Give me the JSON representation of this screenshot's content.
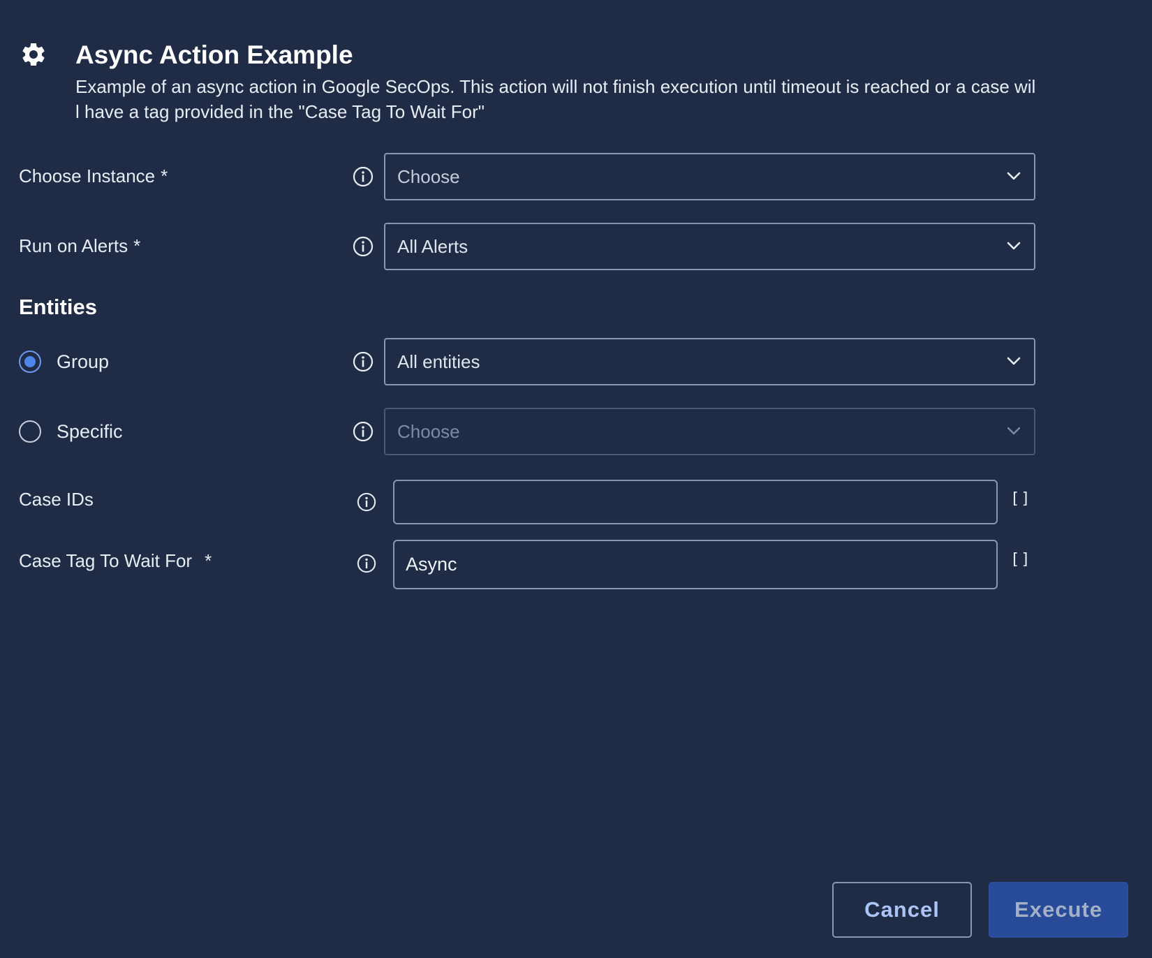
{
  "dialog": {
    "title": "Async Action Example",
    "description": "Example of an async action in Google SecOps. This action will not finish execution until timeout is reached or a case will have a tag provided in the \"Case Tag To Wait For\""
  },
  "fields": {
    "instance": {
      "label": "Choose Instance",
      "required": "*",
      "value": "Choose"
    },
    "alerts": {
      "label": "Run on Alerts",
      "required": "*",
      "value": "All Alerts"
    }
  },
  "entities": {
    "heading": "Entities",
    "group": {
      "label": "Group",
      "value": "All entities",
      "selected": true
    },
    "specific": {
      "label": "Specific",
      "value": "Choose",
      "selected": false
    }
  },
  "params": {
    "case_ids": {
      "label": "Case IDs",
      "value": "",
      "bracket": "[]"
    },
    "case_tag": {
      "label": "Case Tag To Wait For",
      "required": "*",
      "value": "Async",
      "bracket": "[]"
    }
  },
  "buttons": {
    "cancel": "Cancel",
    "execute": "Execute"
  },
  "icons": {
    "header": "gear-icon",
    "info": "info-icon",
    "dropdown": "chevron-down-icon"
  },
  "colors": {
    "background": "#202c46",
    "accent": "#4f86ec",
    "execute_bg": "#274b99"
  }
}
